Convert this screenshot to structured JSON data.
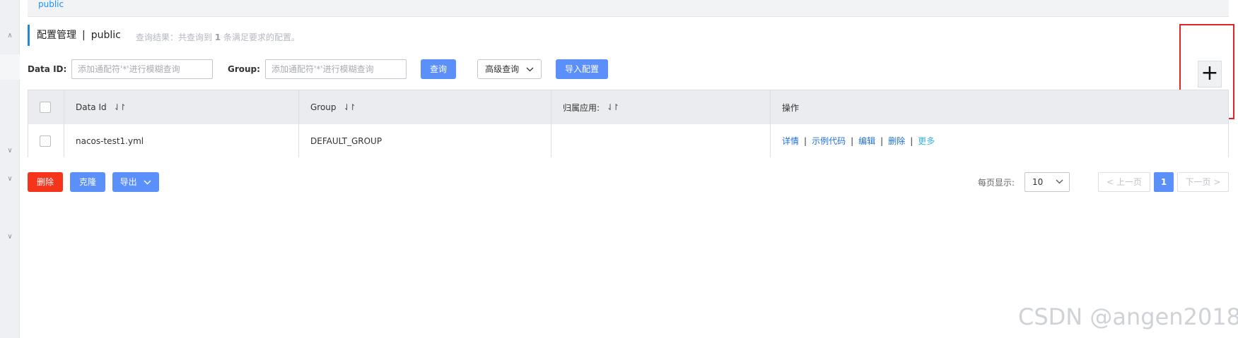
{
  "namespace_bar": {
    "link": "public"
  },
  "title": {
    "main": "配置管理",
    "separator": "|",
    "namespace": "public"
  },
  "query_result": {
    "prefix": "查询结果：共查询到",
    "count": "1",
    "suffix": "条满足要求的配置。"
  },
  "search": {
    "data_id_label": "Data ID:",
    "data_id_placeholder": "添加通配符'*'进行模糊查询",
    "group_label": "Group:",
    "group_placeholder": "添加通配符'*'进行模糊查询",
    "query_button": "查询",
    "advanced_query": "高级查询",
    "import_button": "导入配置"
  },
  "add_button": {
    "symbol": "+"
  },
  "table": {
    "headers": {
      "data_id": "Data Id",
      "group": "Group",
      "app": "归属应用:",
      "actions": "操作"
    },
    "sort_symbol": "⇃↾",
    "rows": [
      {
        "data_id": "nacos-test1.yml",
        "group": "DEFAULT_GROUP",
        "app": "",
        "actions": [
          "详情",
          "示例代码",
          "编辑",
          "删除",
          "更多"
        ]
      }
    ],
    "action_separator": "|"
  },
  "bottom": {
    "delete_button": "删除",
    "clone_button": "克隆",
    "export_button": "导出",
    "page_size_label": "每页显示:",
    "page_size": "10",
    "prev_button": "上一页",
    "current_page": "1",
    "next_button": "下一页"
  },
  "watermark": "CSDN @angen2018",
  "colors": {
    "primary": "#5b8ff9",
    "danger": "#f5341c",
    "link": "#1e6fd9",
    "highlight_box": "#e3242b"
  }
}
